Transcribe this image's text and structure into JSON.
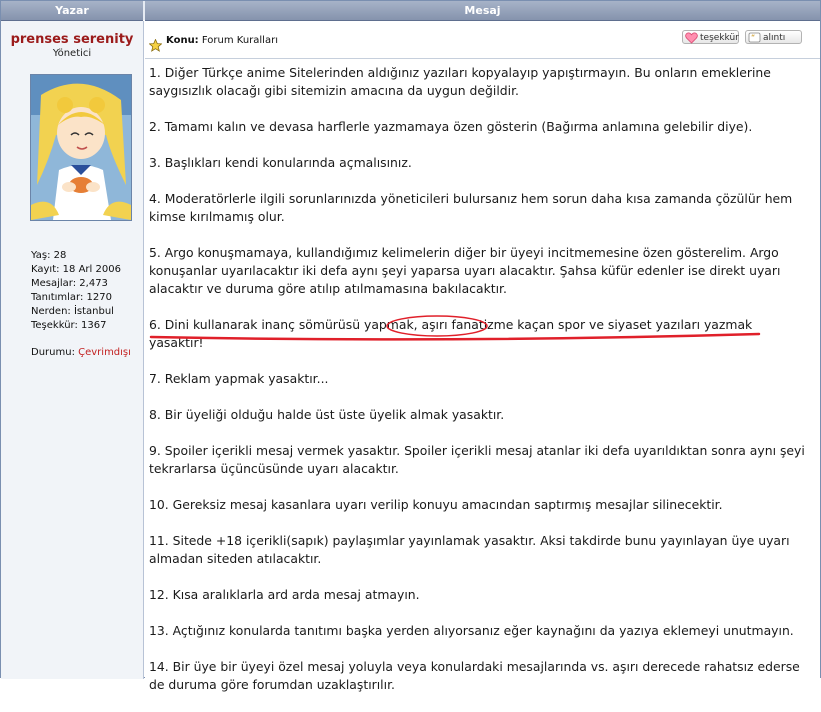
{
  "header": {
    "author_col": "Yazar",
    "message_col": "Mesaj"
  },
  "user": {
    "name": "prenses serenity",
    "title": "Yönetici",
    "stats": [
      "Yaş: 28",
      "Kayıt: 18 Arl 2006",
      "Mesajlar: 2,473",
      "Tanıtımlar: 1270",
      "Nerden: İstanbul",
      "Teşekkür: 1367"
    ],
    "status_label": "Durumu:",
    "status_value": "Çevrimdışı"
  },
  "post": {
    "subject_label": "Konu:",
    "subject": "Forum Kuralları",
    "thanks_label": "teşekkür",
    "quote_label": "alıntı",
    "rules": [
      "1. Diğer Türkçe anime Sitelerinden aldığınız yazıları kopyalayıp yapıştırmayın. Bu onların emeklerine saygısızlık olacağı gibi sitemizin amacına da uygun değildir.",
      "2. Tamamı kalın ve devasa harflerle yazmamaya özen gösterin (Bağırma anlamına gelebilir diye).",
      "3. Başlıkları kendi konularında açmalısınız.",
      "4. Moderatörlerle ilgili sorunlarınızda yöneticileri bulursanız hem sorun daha kısa zamanda çözülür hem kimse kırılmamış olur.",
      "5. Argo konuşmamaya, kullandığımız kelimelerin diğer bir üyeyi incitmemesine özen gösterelim. Argo konuşanlar uyarılacaktır iki defa aynı şeyi yaparsa uyarı alacaktır. Şahsa küfür edenler ise direkt uyarı alacaktır ve duruma göre atılıp atılmamasına bakılacaktır.",
      "6. Dini kullanarak inanç sömürüsü yapmak, aşırı fanatizme kaçan spor ve siyaset yazıları yazmak yasaktır!",
      "7. Reklam yapmak yasaktır...",
      "8. Bir üyeliği olduğu halde üst üste üyelik almak yasaktır.",
      "9. Spoiler içerikli mesaj vermek yasaktır. Spoiler içerikli mesaj atanlar iki defa uyarıldıktan sonra aynı şeyi tekrarlarsa üçüncüsünde uyarı alacaktır.",
      "10. Gereksiz mesaj kasanlara uyarı verilip konuyu amacından saptırmış mesajlar silinecektir.",
      "11. Sitede +18 içerikli(sapık) paylaşımlar yayınlamak yasaktır. Aksi takdirde bunu yayınlayan üye uyarı almadan siteden atılacaktır.",
      "12. Kısa aralıklarla ard arda mesaj atmayın.",
      "13. Açtığınız konularda tanıtımı başka yerden alıyorsanız eğer kaynağını da yazıya eklemeyi unutmayın.",
      "14. Bir üye bir üyeyi özel mesaj yoluyla veya konulardaki mesajlarında vs. aşırı derecede rahatsız ederse de duruma göre forumdan uzaklaştırılır."
    ]
  },
  "colors": {
    "username": "#9b1b1b",
    "status_offline": "#c32222",
    "annotation_red": "#e0202a",
    "header_bg": "#8593ad"
  }
}
